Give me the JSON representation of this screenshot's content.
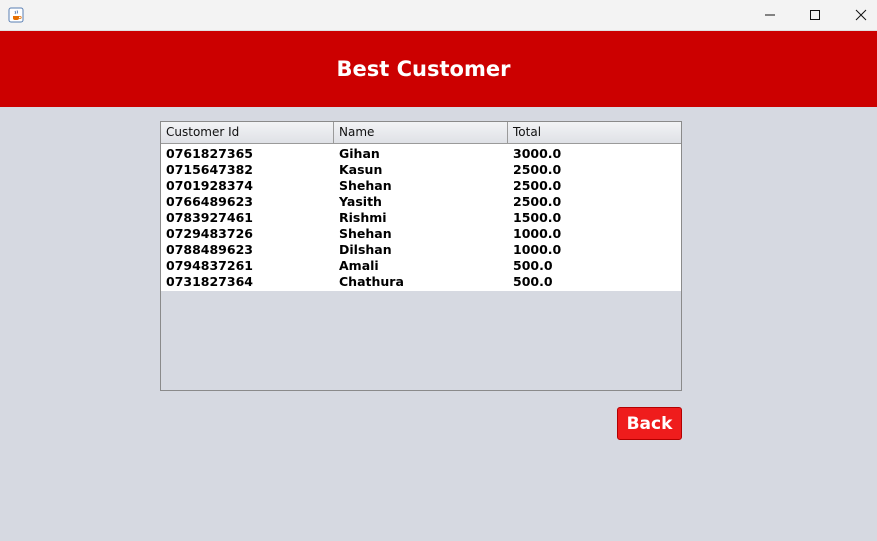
{
  "window": {
    "app_icon": "java-cup-icon",
    "controls": {
      "minimize_icon": "minimize-icon",
      "maximize_icon": "maximize-icon",
      "close_icon": "close-icon"
    }
  },
  "header": {
    "title": "Best Customer",
    "background_color": "#cc0000"
  },
  "table": {
    "columns": [
      "Customer Id",
      "Name",
      "Total"
    ],
    "rows": [
      [
        "0761827365",
        "Gihan",
        "3000.0"
      ],
      [
        "0715647382",
        "Kasun",
        "2500.0"
      ],
      [
        "0701928374",
        "Shehan",
        "2500.0"
      ],
      [
        "0766489623",
        "Yasith",
        "2500.0"
      ],
      [
        "0783927461",
        "Rishmi",
        "1500.0"
      ],
      [
        "0729483726",
        "Shehan",
        "1000.0"
      ],
      [
        "0788489623",
        "Dilshan",
        "1000.0"
      ],
      [
        "0794837261",
        "Amali",
        "500.0"
      ],
      [
        "0731827364",
        "Chathura",
        "500.0"
      ]
    ]
  },
  "actions": {
    "back_label": "Back",
    "back_color": "#ef1c1c"
  }
}
